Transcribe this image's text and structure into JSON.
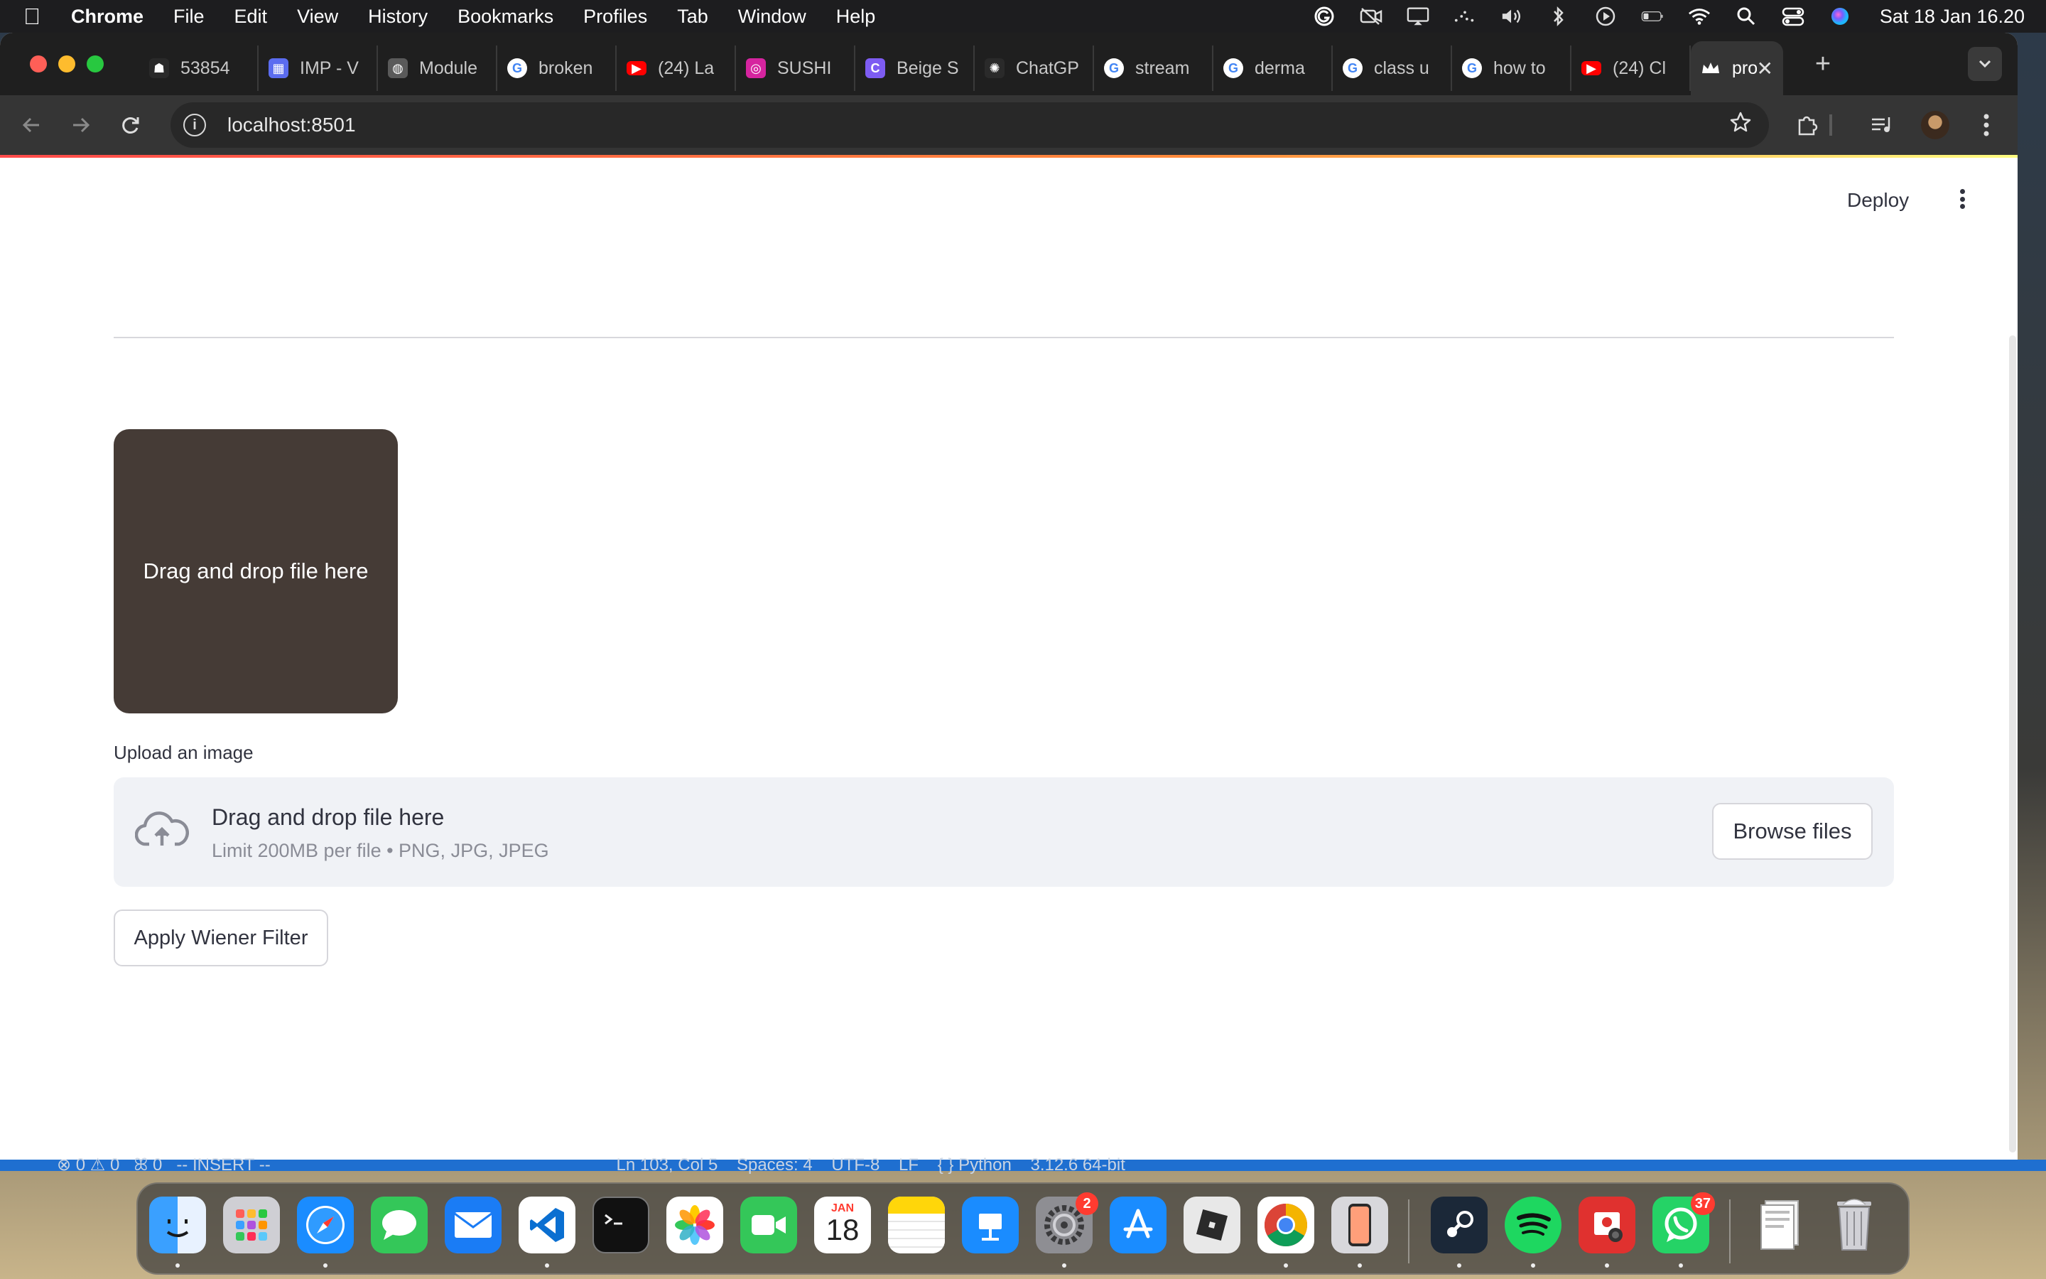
{
  "menubar": {
    "app_name": "Chrome",
    "menus": [
      "File",
      "Edit",
      "View",
      "History",
      "Bookmarks",
      "Profiles",
      "Tab",
      "Window",
      "Help"
    ],
    "status_icons": [
      "grammarly-icon",
      "no-camera-icon",
      "screen-mirroring-icon",
      "spotlight-dots-icon",
      "volume-icon",
      "bluetooth-icon",
      "play-icon",
      "battery-icon",
      "wifi-icon",
      "search-icon",
      "control-center-icon",
      "siri-icon"
    ],
    "clock": "Sat 18 Jan 16.20"
  },
  "browser": {
    "tabs": [
      {
        "title": "53854",
        "icon": "ghost-icon",
        "color": "#2a2a2a"
      },
      {
        "title": "IMP - V",
        "icon": "app-icon",
        "color": "#5b6cf0"
      },
      {
        "title": "Module",
        "icon": "globe-icon",
        "color": "#5a5a5a"
      },
      {
        "title": "broken",
        "icon": "google-icon",
        "color": "#ffffff"
      },
      {
        "title": "(24) La",
        "icon": "youtube-icon",
        "color": "#ff0000"
      },
      {
        "title": "SUSHI",
        "icon": "instagram-icon",
        "color": "#d6249f"
      },
      {
        "title": "Beige S",
        "icon": "canva-icon",
        "color": "#7d5cf2"
      },
      {
        "title": "ChatGP",
        "icon": "chatgpt-icon",
        "color": "#2a2a2a"
      },
      {
        "title": "stream",
        "icon": "google-icon",
        "color": "#ffffff"
      },
      {
        "title": "derma",
        "icon": "google-icon",
        "color": "#ffffff"
      },
      {
        "title": "class u",
        "icon": "google-icon",
        "color": "#ffffff"
      },
      {
        "title": "how to",
        "icon": "google-icon",
        "color": "#ffffff"
      },
      {
        "title": "(24) Cl",
        "icon": "youtube-icon",
        "color": "#ff0000"
      }
    ],
    "active_tab": {
      "title": "pro",
      "icon": "streamlit-crown-icon"
    },
    "url": "localhost:8501"
  },
  "app": {
    "deploy_label": "Deploy",
    "image_placeholder_text": "Drag and drop file here",
    "uploader_label": "Upload an image",
    "dropzone_title": "Drag and drop file here",
    "dropzone_limit": "Limit 200MB per file • PNG, JPG, JPEG",
    "browse_label": "Browse files",
    "apply_label": "Apply Wiener Filter"
  },
  "background_editor_status": "⊗ 0 ⚠ 0   ꕤ 0   -- INSERT --                                                                         Ln 103, Col 5    Spaces: 4    UTF-8    LF    { } Python    3.12.6 64-bit",
  "dock": {
    "calendar_month": "JAN",
    "calendar_day": "18",
    "settings_badge": "2",
    "whatsapp_badge": "37"
  },
  "colors": {
    "streamlit_accent": "#ff4b4b",
    "image_box": "#453b36",
    "dropzone_bg": "#f0f2f6",
    "text": "#31333f"
  }
}
